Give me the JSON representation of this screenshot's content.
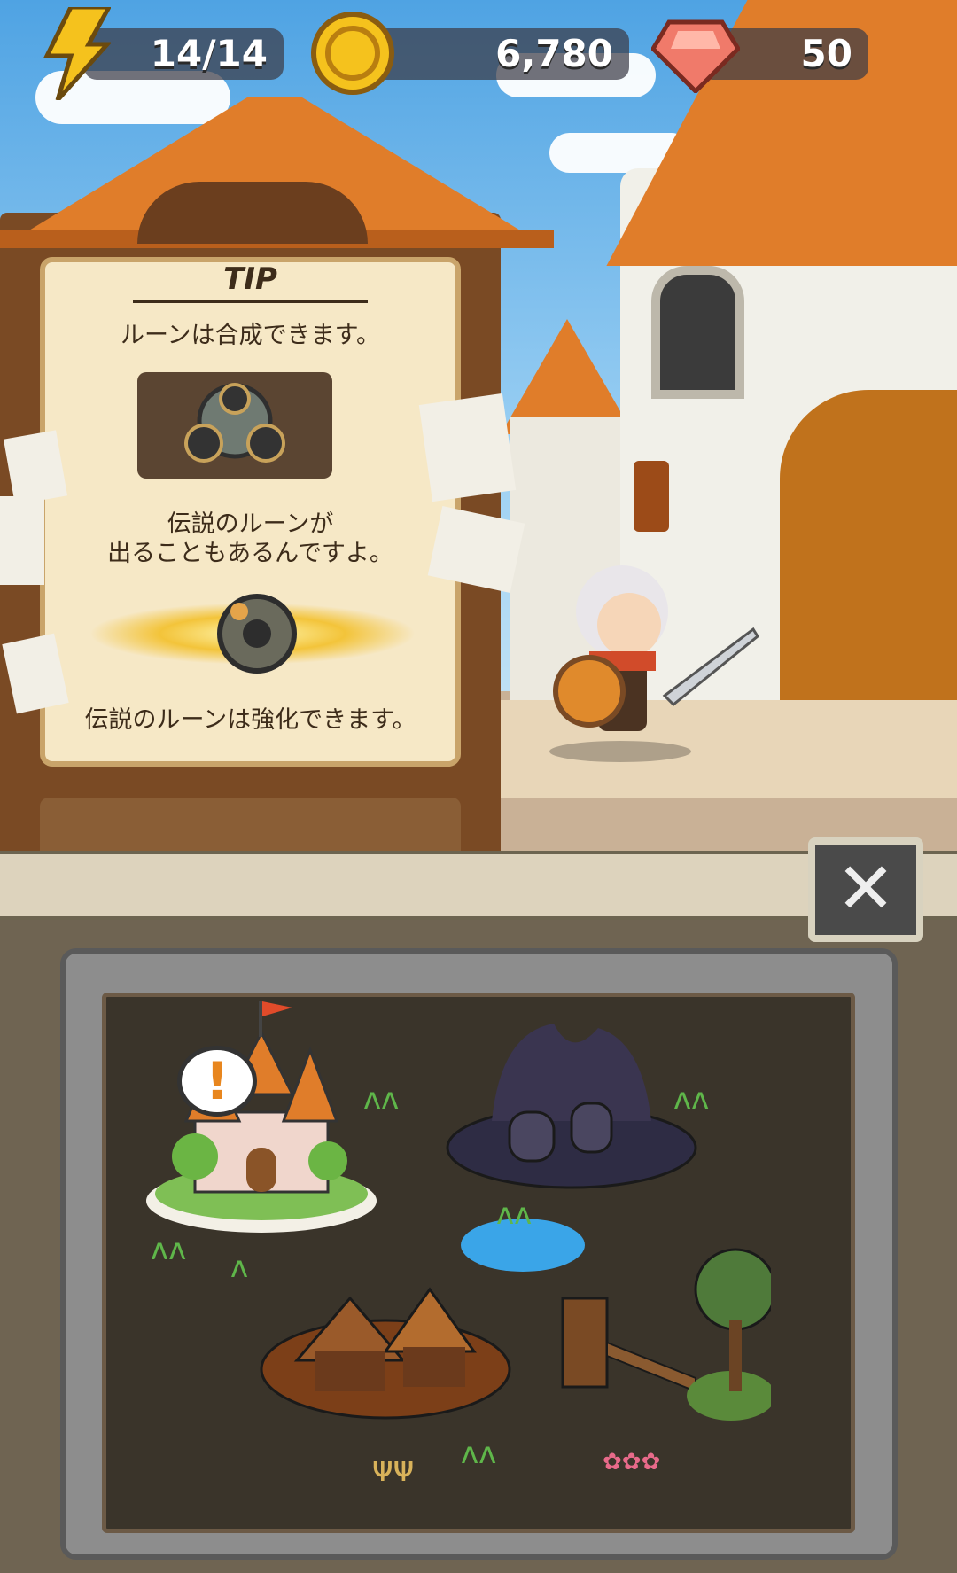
{
  "hud": {
    "energy": "14/14",
    "gold": "6,780",
    "gems": "50",
    "energy_icon": "lightning-icon",
    "gold_icon": "gold-coin-icon",
    "gem_icon": "ruby-gem-icon"
  },
  "tip": {
    "title": "TIP",
    "line1": "ルーンは合成できます。",
    "line2a": "伝説のルーンが",
    "line2b": "出ることもあるんですよ。",
    "line3": "伝説のルーンは強化できます。"
  },
  "map": {
    "alert_symbol": "!"
  },
  "close_icon": "close-icon",
  "colors": {
    "roof_orange": "#e07d2a",
    "wood_brown": "#7a4a24",
    "parchment": "#f6e8c6"
  }
}
